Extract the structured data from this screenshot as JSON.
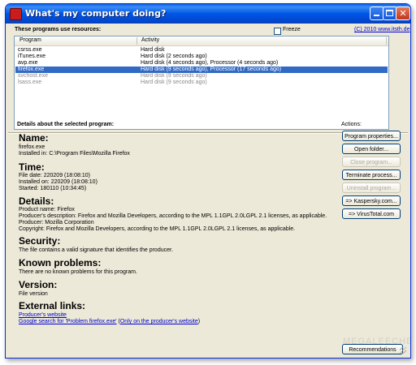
{
  "window": {
    "title": "What's my computer doing?",
    "controls": [
      "minimize",
      "maximize",
      "close"
    ]
  },
  "top": {
    "section_label": "These programs use resources:",
    "freeze_label": "Freeze",
    "freeze_checked": false,
    "copyright_link": "(C) 2010 www.itsth.de"
  },
  "list": {
    "columns": [
      "Program",
      "Activity"
    ],
    "rows": [
      {
        "program": "csrss.exe",
        "activity": "Hard disk",
        "state": "normal"
      },
      {
        "program": "iTunes.exe",
        "activity": "Hard disk (2 seconds ago)",
        "state": "normal"
      },
      {
        "program": "avp.exe",
        "activity": "Hard disk (4 seconds ago), Processor (4 seconds ago)",
        "state": "normal"
      },
      {
        "program": "firefox.exe",
        "activity": "Hard disk (9 seconds ago), Processor (17 seconds ago)",
        "state": "selected"
      },
      {
        "program": "svchost.exe",
        "activity": "Hard disk (9 seconds ago)",
        "state": "grey"
      },
      {
        "program": "lsass.exe",
        "activity": "Hard disk (9 seconds ago)",
        "state": "grey"
      }
    ]
  },
  "details": {
    "section_label": "Details about the selected program:",
    "name_heading": "Name:",
    "name_line1": "firefox.exe",
    "name_line2": "Installed in: C:\\Program Files\\Mozilla Firefox",
    "time_heading": "Time:",
    "time_line1": "File date: 220209 (18:08:10)",
    "time_line2": "Installed on: 220209 (18:08:10)",
    "time_line3": "Started: 180110 (10:34:45)",
    "details_heading": "Details:",
    "details_line1": "Product name: Firefox",
    "details_line2": "Producer's description: Firefox and Mozilla Developers, according to the MPL 1.1GPL 2.0LGPL 2.1 licenses, as applicable.",
    "details_line3": "Producer: Mozilla Corporation",
    "details_line4": "Copyright: Firefox and Mozilla Developers, according to the MPL 1.1GPL 2.0LGPL 2.1 licenses, as applicable.",
    "security_heading": "Security:",
    "security_line": "The file contains a valid signature that identifies the producer.",
    "problems_heading": "Known problems:",
    "problems_line": "There are no known problems for this program.",
    "version_heading": "Version:",
    "version_line": "File version",
    "links_heading": "External links:",
    "link_producer": "Producer's website",
    "link_google": "Google search for 'Problem firefox.exe'",
    "link_paren_open": "(",
    "link_only_producer": "Only on the producer's website",
    "link_paren_close": ")"
  },
  "actions": {
    "label": "Actions:",
    "buttons": [
      {
        "label": "Program properties...",
        "enabled": true
      },
      {
        "label": "Open folder...",
        "enabled": true
      },
      {
        "label": "Close program...",
        "enabled": false
      },
      {
        "label": "Terminate process...",
        "enabled": true
      },
      {
        "label": "Uninstall program...",
        "enabled": false
      },
      {
        "label": "=> Kaspersky.com...",
        "enabled": true
      },
      {
        "label": "=> VirusTotal.com",
        "enabled": true
      }
    ],
    "recommendations": "Recommendations"
  },
  "watermark": "MEGALEECHER.NET",
  "colors": {
    "selection": "#316ac5",
    "titlebar": "#0055e5",
    "face": "#ece9d8",
    "link": "#0000cc"
  }
}
